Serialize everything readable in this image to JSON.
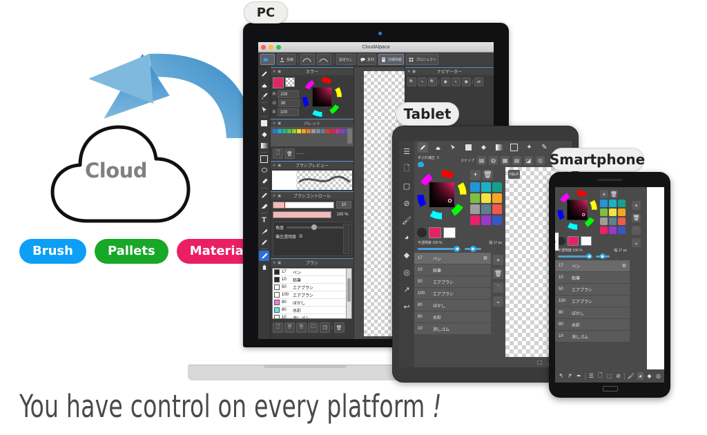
{
  "caption": {
    "text": "You have control on every platform",
    "mark": "!"
  },
  "cloud": {
    "label": "Cloud"
  },
  "feature_pills": [
    {
      "label": "Brush",
      "color": "#0d9ef5"
    },
    {
      "label": "Pallets",
      "color": "#18a828"
    },
    {
      "label": "Materials",
      "color": "#ea1e63"
    }
  ],
  "device_tags": {
    "pc": "PC",
    "tablet": "Tablet",
    "smartphone": "Smartphone"
  },
  "pc": {
    "window_title": "CloudAlpaca",
    "toolbar": [
      {
        "name": "cloud-button",
        "label": ""
      },
      {
        "name": "upload-button",
        "label": "投稿"
      },
      {
        "name": "curve-tool-1",
        "label": ""
      },
      {
        "name": "curve-tool-2",
        "label": ""
      },
      {
        "name": "preset-select",
        "label": "設定なし"
      },
      {
        "name": "material-button",
        "label": "素材"
      },
      {
        "name": "detail-button",
        "label": "詳細情報"
      },
      {
        "name": "project-button",
        "label": "プロジェクト"
      }
    ],
    "panels": {
      "color": "カラー",
      "palette": "パレット",
      "brush_preview": "ブラシプレビュー",
      "brush_control": "ブラシコントロール",
      "brush": "ブラシ",
      "navigator": "ナビゲーター"
    },
    "color": {
      "r_label": "R",
      "r_value": "228",
      "g_label": "G",
      "g_value": "36",
      "b_label": "B",
      "b_value": "100",
      "current_hex": "#e42464"
    },
    "palette_swatches": [
      "#1f7fe0",
      "#16b3d8",
      "#17b98f",
      "#56c442",
      "#8ed02f",
      "#e8e024",
      "#f2a31c",
      "#f07b1c",
      "#9a9a9a",
      "#7b8ea0",
      "#5f7f9e",
      "#e8342e",
      "#e41e55",
      "#d62fa0",
      "#9b37c9",
      "#4a55c4"
    ],
    "brush_control": {
      "size_value": "10",
      "opacity_value": "100 %",
      "angle_label": "角度",
      "angle_value": "0",
      "pressure_label": "筆圧透明度"
    },
    "brushes": [
      {
        "num": "17",
        "name": "ペン",
        "chip": "#2b2b2b"
      },
      {
        "num": "10",
        "name": "鉛筆",
        "chip": "#2b2b2b"
      },
      {
        "num": "50",
        "name": "エアブラシ",
        "chip": "#ffffff"
      },
      {
        "num": "100",
        "name": "エアブラシ",
        "chip": "#ffffff"
      },
      {
        "num": "80",
        "name": "ぼかし",
        "chip": "#f07ae0"
      },
      {
        "num": "80",
        "name": "水彩",
        "chip": "#5fe3f2"
      },
      {
        "num": "10",
        "name": "消しゴム",
        "chip": "#ffffff"
      }
    ]
  },
  "tablet": {
    "stabilizer_label": "手ぶれ補正",
    "stabilizer_value": "0",
    "snap_label": "スナップ",
    "opacity_label": "不透明度",
    "opacity_value": "100 %",
    "width_label": "幅",
    "width_value": "17 px",
    "help_badge": "HELP",
    "swatches": [
      "#2196d6",
      "#16b3c8",
      "#14a08b",
      "#7cc043",
      "#f2e33f",
      "#f5a623",
      "#9e9e9e",
      "#5f8090",
      "#f05a4a",
      "#e8226b",
      "#9b37c9",
      "#3a56c4"
    ],
    "brushes": [
      {
        "num": "17",
        "name": "ペン"
      },
      {
        "num": "10",
        "name": "鉛筆"
      },
      {
        "num": "50",
        "name": "エアブラシ"
      },
      {
        "num": "100",
        "name": "エアブラシ"
      },
      {
        "num": "80",
        "name": "ぼかし"
      },
      {
        "num": "80",
        "name": "水彩"
      },
      {
        "num": "10",
        "name": "消しゴム"
      }
    ]
  },
  "phone": {
    "opacity_label": "不透明度",
    "opacity_value": "100 %",
    "width_label": "幅",
    "width_value": "17 px",
    "swatches": [
      "#2196d6",
      "#16b3c8",
      "#14a08b",
      "#7cc043",
      "#f2e33f",
      "#f5a623",
      "#9e9e9e",
      "#5f8090",
      "#f05a4a",
      "#e8226b",
      "#9b37c9",
      "#3a56c4"
    ],
    "brushes": [
      {
        "num": "17",
        "name": "ペン"
      },
      {
        "num": "10",
        "name": "鉛筆"
      },
      {
        "num": "50",
        "name": "エアブラシ"
      },
      {
        "num": "100",
        "name": "エアブラシ"
      },
      {
        "num": "80",
        "name": "ぼかし"
      },
      {
        "num": "80",
        "name": "水彩"
      },
      {
        "num": "10",
        "name": "消しゴム"
      }
    ]
  }
}
